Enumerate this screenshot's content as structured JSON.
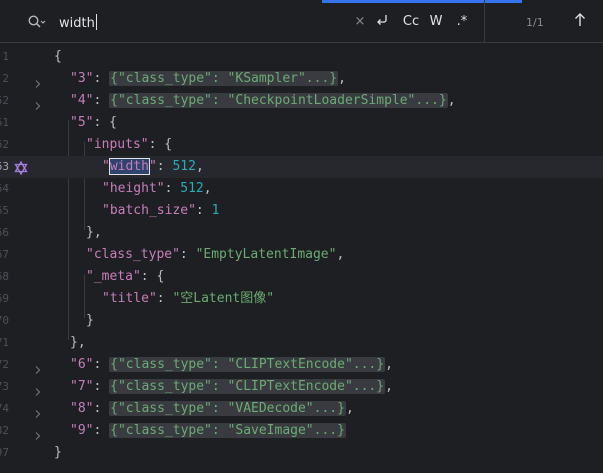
{
  "search": {
    "query": "width",
    "clear_label": "×",
    "regex_label": ".*",
    "case_label": "Cc",
    "word_label": "W",
    "match_count": "1/1"
  },
  "lines": [
    {
      "ln": "1",
      "indent": 0,
      "fold": false,
      "tokens": [
        {
          "t": "{",
          "c": "p"
        }
      ]
    },
    {
      "ln": "2",
      "indent": 1,
      "fold": true,
      "tokens": [
        {
          "t": "\"3\"",
          "c": "k"
        },
        {
          "t": ": ",
          "c": "p"
        },
        {
          "t": "{\"class_type\": \"KSampler\"...}",
          "c": "fold"
        },
        {
          "t": ",",
          "c": "p"
        }
      ]
    },
    {
      "ln": "52",
      "indent": 1,
      "fold": true,
      "tokens": [
        {
          "t": "\"4\"",
          "c": "k"
        },
        {
          "t": ": ",
          "c": "p"
        },
        {
          "t": "{\"class_type\": \"CheckpointLoaderSimple\"...}",
          "c": "fold"
        },
        {
          "t": ",",
          "c": "p"
        }
      ]
    },
    {
      "ln": "61",
      "indent": 1,
      "fold": false,
      "tokens": [
        {
          "t": "\"5\"",
          "c": "k"
        },
        {
          "t": ": {",
          "c": "p"
        }
      ]
    },
    {
      "ln": "62",
      "indent": 2,
      "fold": false,
      "tokens": [
        {
          "t": "\"inputs\"",
          "c": "k"
        },
        {
          "t": ": {",
          "c": "p"
        }
      ]
    },
    {
      "ln": "63",
      "indent": 3,
      "fold": false,
      "current": true,
      "tokens": [
        {
          "t": "\"",
          "c": "k"
        },
        {
          "t": "width",
          "c": "hl"
        },
        {
          "t": "\"",
          "c": "k"
        },
        {
          "t": ": ",
          "c": "p"
        },
        {
          "t": "512",
          "c": "n"
        },
        {
          "t": ",",
          "c": "p"
        }
      ]
    },
    {
      "ln": "64",
      "indent": 3,
      "fold": false,
      "tokens": [
        {
          "t": "\"height\"",
          "c": "k"
        },
        {
          "t": ": ",
          "c": "p"
        },
        {
          "t": "512",
          "c": "n"
        },
        {
          "t": ",",
          "c": "p"
        }
      ]
    },
    {
      "ln": "65",
      "indent": 3,
      "fold": false,
      "tokens": [
        {
          "t": "\"batch_size\"",
          "c": "k"
        },
        {
          "t": ": ",
          "c": "p"
        },
        {
          "t": "1",
          "c": "n"
        }
      ]
    },
    {
      "ln": "66",
      "indent": 2,
      "fold": false,
      "tokens": [
        {
          "t": "},",
          "c": "p"
        }
      ]
    },
    {
      "ln": "67",
      "indent": 2,
      "fold": false,
      "tokens": [
        {
          "t": "\"class_type\"",
          "c": "k"
        },
        {
          "t": ": ",
          "c": "p"
        },
        {
          "t": "\"EmptyLatentImage\"",
          "c": "s"
        },
        {
          "t": ",",
          "c": "p"
        }
      ]
    },
    {
      "ln": "68",
      "indent": 2,
      "fold": false,
      "tokens": [
        {
          "t": "\"_meta\"",
          "c": "k"
        },
        {
          "t": ": {",
          "c": "p"
        }
      ]
    },
    {
      "ln": "69",
      "indent": 3,
      "fold": false,
      "tokens": [
        {
          "t": "\"title\"",
          "c": "k"
        },
        {
          "t": ": ",
          "c": "p"
        },
        {
          "t": "\"空Latent图像\"",
          "c": "s"
        }
      ]
    },
    {
      "ln": "70",
      "indent": 2,
      "fold": false,
      "tokens": [
        {
          "t": "}",
          "c": "p"
        }
      ]
    },
    {
      "ln": "71",
      "indent": 1,
      "fold": false,
      "tokens": [
        {
          "t": "},",
          "c": "p"
        }
      ]
    },
    {
      "ln": "72",
      "indent": 1,
      "fold": true,
      "tokens": [
        {
          "t": "\"6\"",
          "c": "k"
        },
        {
          "t": ": ",
          "c": "p"
        },
        {
          "t": "{\"class_type\": \"CLIPTextEncode\"...}",
          "c": "fold"
        },
        {
          "t": ",",
          "c": "p"
        }
      ]
    },
    {
      "ln": "73",
      "indent": 1,
      "fold": true,
      "tokens": [
        {
          "t": "\"7\"",
          "c": "k"
        },
        {
          "t": ": ",
          "c": "p"
        },
        {
          "t": "{\"class_type\": \"CLIPTextEncode\"...}",
          "c": "fold"
        },
        {
          "t": ",",
          "c": "p"
        }
      ]
    },
    {
      "ln": "74",
      "indent": 1,
      "fold": true,
      "tokens": [
        {
          "t": "\"8\"",
          "c": "k"
        },
        {
          "t": ": ",
          "c": "p"
        },
        {
          "t": "{\"class_type\": \"VAEDecode\"...}",
          "c": "fold"
        },
        {
          "t": ",",
          "c": "p"
        }
      ]
    },
    {
      "ln": "82",
      "indent": 1,
      "fold": true,
      "tokens": [
        {
          "t": "\"9\"",
          "c": "k"
        },
        {
          "t": ": ",
          "c": "p"
        },
        {
          "t": "{\"class_type\": \"SaveImage\"...}",
          "c": "fold"
        }
      ]
    },
    {
      "ln": "97",
      "indent": 0,
      "fold": false,
      "tokens": [
        {
          "t": "}",
          "c": "p"
        }
      ]
    }
  ],
  "colors": {
    "accent": "#3574f0",
    "key": "#c77dbb",
    "string": "#6aab73",
    "number": "#2aacb8",
    "match": "#2e436e"
  },
  "icons": {
    "search": "search-options-icon",
    "clear": "close-icon",
    "newline": "return-icon",
    "prev": "arrow-up-icon",
    "bookmark": "bookmark-icon",
    "fold": "chevron-right-icon"
  }
}
